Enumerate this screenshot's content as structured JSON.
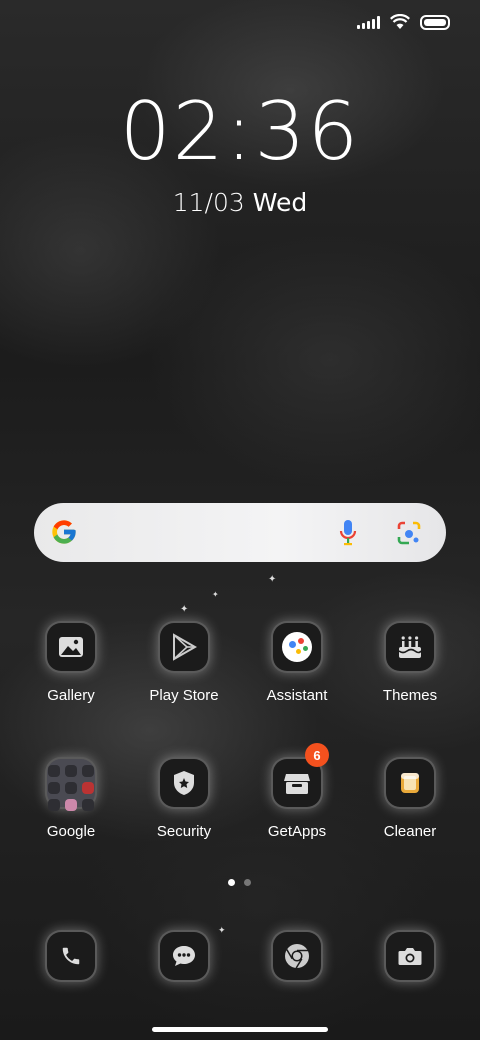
{
  "status_bar": {
    "icons": [
      "signal-icon",
      "wifi-icon",
      "battery-icon"
    ]
  },
  "clock": {
    "time": "02:36",
    "date_num": "11/03",
    "date_day": "Wed"
  },
  "search_bar": {
    "icons": [
      "google-logo-icon",
      "mic-icon",
      "google-lens-icon"
    ]
  },
  "apps": [
    {
      "label": "Gallery",
      "icon": "gallery-icon"
    },
    {
      "label": "Play Store",
      "icon": "play-store-icon"
    },
    {
      "label": "Assistant",
      "icon": "assistant-icon"
    },
    {
      "label": "Themes",
      "icon": "themes-icon"
    },
    {
      "label": "Google",
      "icon": "google-folder-icon"
    },
    {
      "label": "Security",
      "icon": "security-icon"
    },
    {
      "label": "GetApps",
      "icon": "getapps-icon",
      "badge": "6"
    },
    {
      "label": "Cleaner",
      "icon": "cleaner-icon"
    }
  ],
  "page_indicator": {
    "pages": 2,
    "current": 1
  },
  "dock": [
    {
      "icon": "phone-icon"
    },
    {
      "icon": "messages-icon"
    },
    {
      "icon": "chrome-icon"
    },
    {
      "icon": "camera-icon"
    }
  ],
  "colors": {
    "badge": "#f4511e",
    "search_bg": "#eeeeef"
  }
}
